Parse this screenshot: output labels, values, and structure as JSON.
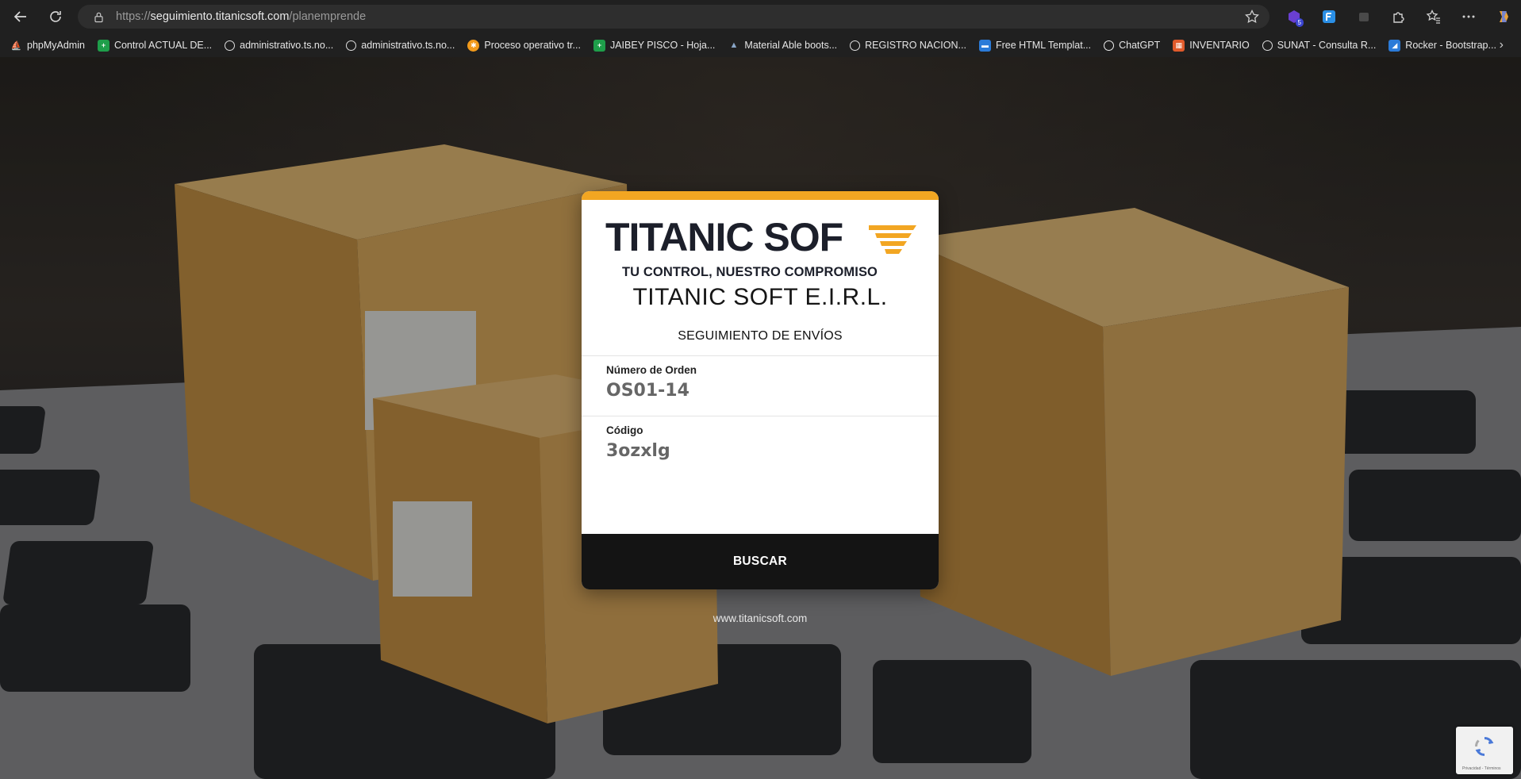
{
  "browser": {
    "url_scheme": "https://",
    "url_host": "seguimiento.titanicsoft.com",
    "url_path": "/planemprende",
    "extension_badge": "5"
  },
  "bookmarks": [
    {
      "label": "phpMyAdmin",
      "color": "#f2a03a"
    },
    {
      "label": "Control ACTUAL DE...",
      "color": "#1e9e4a"
    },
    {
      "label": "administrativo.ts.no...",
      "color": "globe"
    },
    {
      "label": "administrativo.ts.no...",
      "color": "globe"
    },
    {
      "label": "Proceso operativo tr...",
      "color": "#f29a1b"
    },
    {
      "label": "JAIBEY PISCO - Hoja...",
      "color": "#1e9e4a"
    },
    {
      "label": "Material Able boots...",
      "color": "#6f8aa8"
    },
    {
      "label": "REGISTRO NACION...",
      "color": "globe"
    },
    {
      "label": "Free HTML Templat...",
      "color": "#2b7bd8"
    },
    {
      "label": "ChatGPT",
      "color": "#ffffff"
    },
    {
      "label": "INVENTARIO",
      "color": "#e05a2b"
    },
    {
      "label": "SUNAT - Consulta R...",
      "color": "globe"
    },
    {
      "label": "Rocker - Bootstrap...",
      "color": "#2b7bd8"
    }
  ],
  "card": {
    "logo_text": "TITANIC SOF",
    "logo_tagline": "TU CONTROL, NUESTRO COMPROMISO",
    "company_name": "TITANIC SOFT E.I.R.L.",
    "subtitle": "SEGUIMIENTO DE ENVÍOS",
    "order_label": "Número de Orden",
    "order_value": "OS01-14",
    "code_label": "Código",
    "code_value": "3ozxlg",
    "button_label": "BUSCAR"
  },
  "footer": {
    "website": "www.titanicsoft.com"
  },
  "recaptcha": {
    "text": "Privacidad - Términos"
  },
  "colors": {
    "accent": "#f2a622",
    "button": "#141414"
  }
}
